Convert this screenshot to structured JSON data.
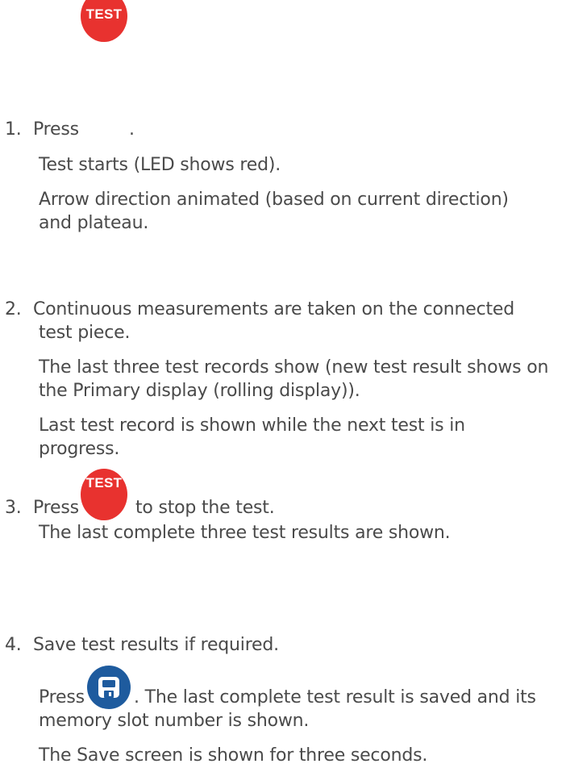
{
  "test_button": {
    "label": "TEST",
    "color": "#e8322f"
  },
  "save_button": {
    "color": "#1e5b9e",
    "icon": "floppy-disk-icon"
  },
  "steps": [
    {
      "number": "1.",
      "prefix": "Press",
      "suffix": ".",
      "lines": [
        "Test starts (LED shows red).",
        "Arrow direction animated (based on current direction)",
        "and plateau."
      ]
    },
    {
      "number": "2.",
      "lines": [
        "Continuous measurements are taken on the connected",
        "test piece.",
        "The last three test records show (new test result shows on",
        "the Primary display (rolling display)).",
        "Last test record is shown while the next test is in",
        "progress."
      ]
    },
    {
      "number": "3.",
      "prefix": "Press",
      "suffix": "to stop the test.",
      "lines": [
        "The last complete three test results are shown."
      ]
    },
    {
      "number": "4.",
      "first": "Save test results if required.",
      "press_prefix": "Press",
      "press_suffix": ". The last complete test result is saved and its",
      "lines": [
        "memory slot number is shown.",
        "The Save screen is shown for three seconds."
      ]
    }
  ]
}
